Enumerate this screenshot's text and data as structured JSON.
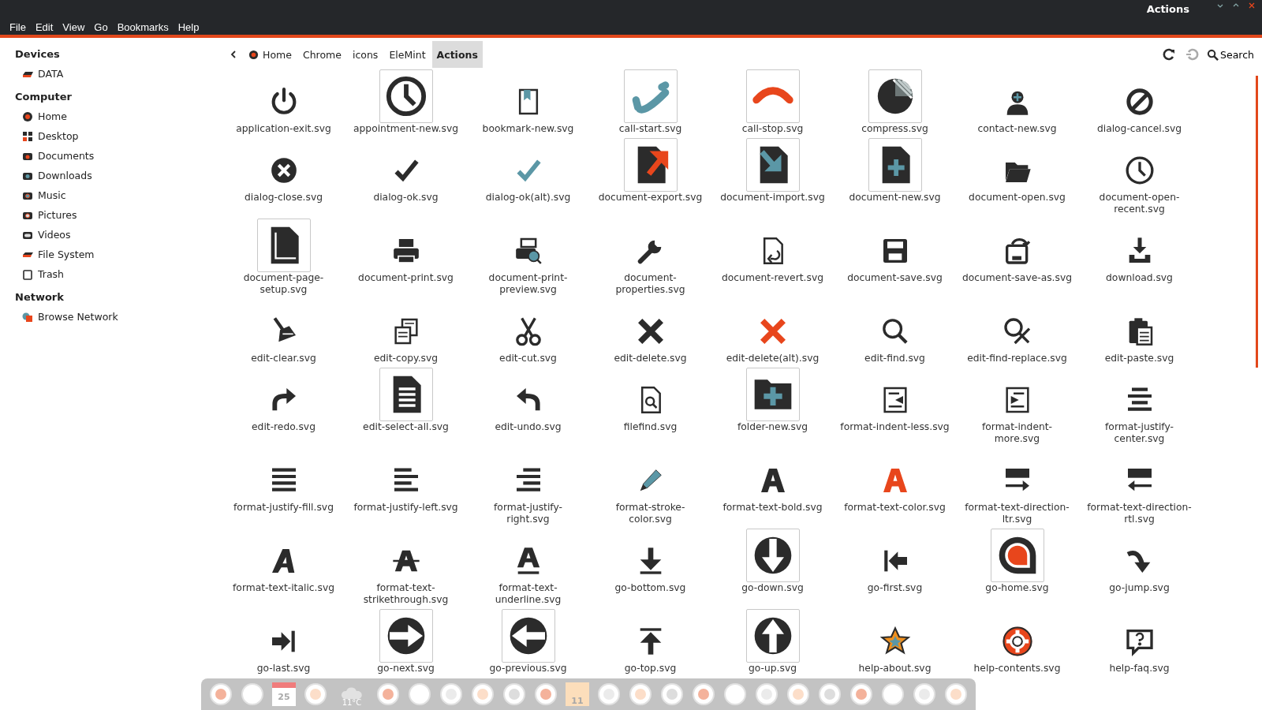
{
  "window": {
    "title": "Actions"
  },
  "menu": [
    "File",
    "Edit",
    "View",
    "Go",
    "Bookmarks",
    "Help"
  ],
  "sidebar": [
    {
      "heading": "Devices",
      "items": [
        {
          "label": "DATA"
        }
      ]
    },
    {
      "heading": "Computer",
      "items": [
        {
          "label": "Home"
        },
        {
          "label": "Desktop"
        },
        {
          "label": "Documents"
        },
        {
          "label": "Downloads"
        },
        {
          "label": "Music"
        },
        {
          "label": "Pictures"
        },
        {
          "label": "Videos"
        },
        {
          "label": "File System"
        },
        {
          "label": "Trash"
        }
      ]
    },
    {
      "heading": "Network",
      "items": [
        {
          "label": "Browse Network"
        }
      ]
    }
  ],
  "path": [
    {
      "label": "Home",
      "selected": false
    },
    {
      "label": "Chrome",
      "selected": false
    },
    {
      "label": "icons",
      "selected": false
    },
    {
      "label": "EleMint",
      "selected": false
    },
    {
      "label": "Actions",
      "selected": true
    }
  ],
  "search": {
    "label": "Search"
  },
  "files": [
    {
      "label": "application-exit.svg",
      "framed": false
    },
    {
      "label": "appointment-new.svg",
      "framed": true
    },
    {
      "label": "bookmark-new.svg",
      "framed": false
    },
    {
      "label": "call-start.svg",
      "framed": true
    },
    {
      "label": "call-stop.svg",
      "framed": true
    },
    {
      "label": "compress.svg",
      "framed": true
    },
    {
      "label": "contact-new.svg",
      "framed": false
    },
    {
      "label": "dialog-cancel.svg",
      "framed": false
    },
    {
      "label": "dialog-close.svg",
      "framed": false
    },
    {
      "label": "dialog-ok.svg",
      "framed": false
    },
    {
      "label": "dialog-ok(alt).svg",
      "framed": false
    },
    {
      "label": "document-export.svg",
      "framed": true
    },
    {
      "label": "document-import.svg",
      "framed": true
    },
    {
      "label": "document-new.svg",
      "framed": true
    },
    {
      "label": "document-open.svg",
      "framed": false
    },
    {
      "label": "document-open-recent.svg",
      "framed": false
    },
    {
      "label": "document-page-setup.svg",
      "framed": true
    },
    {
      "label": "document-print.svg",
      "framed": false
    },
    {
      "label": "document-print-preview.svg",
      "framed": false
    },
    {
      "label": "document-properties.svg",
      "framed": false
    },
    {
      "label": "document-revert.svg",
      "framed": false
    },
    {
      "label": "document-save.svg",
      "framed": false
    },
    {
      "label": "document-save-as.svg",
      "framed": false
    },
    {
      "label": "download.svg",
      "framed": false
    },
    {
      "label": "edit-clear.svg",
      "framed": false
    },
    {
      "label": "edit-copy.svg",
      "framed": false
    },
    {
      "label": "edit-cut.svg",
      "framed": false
    },
    {
      "label": "edit-delete.svg",
      "framed": false
    },
    {
      "label": "edit-delete(alt).svg",
      "framed": false
    },
    {
      "label": "edit-find.svg",
      "framed": false
    },
    {
      "label": "edit-find-replace.svg",
      "framed": false
    },
    {
      "label": "edit-paste.svg",
      "framed": false
    },
    {
      "label": "edit-redo.svg",
      "framed": false
    },
    {
      "label": "edit-select-all.svg",
      "framed": true
    },
    {
      "label": "edit-undo.svg",
      "framed": false
    },
    {
      "label": "filefind.svg",
      "framed": false
    },
    {
      "label": "folder-new.svg",
      "framed": true
    },
    {
      "label": "format-indent-less.svg",
      "framed": false
    },
    {
      "label": "format-indent-more.svg",
      "framed": false
    },
    {
      "label": "format-justify-center.svg",
      "framed": false
    },
    {
      "label": "format-justify-fill.svg",
      "framed": false
    },
    {
      "label": "format-justify-left.svg",
      "framed": false
    },
    {
      "label": "format-justify-right.svg",
      "framed": false
    },
    {
      "label": "format-stroke-color.svg",
      "framed": false
    },
    {
      "label": "format-text-bold.svg",
      "framed": false
    },
    {
      "label": "format-text-color.svg",
      "framed": false
    },
    {
      "label": "format-text-direction-ltr.svg",
      "framed": false
    },
    {
      "label": "format-text-direction-rtl.svg",
      "framed": false
    },
    {
      "label": "format-text-italic.svg",
      "framed": false
    },
    {
      "label": "format-text-strikethrough.svg",
      "framed": false
    },
    {
      "label": "format-text-underline.svg",
      "framed": false
    },
    {
      "label": "go-bottom.svg",
      "framed": false
    },
    {
      "label": "go-down.svg",
      "framed": true
    },
    {
      "label": "go-first.svg",
      "framed": false
    },
    {
      "label": "go-home.svg",
      "framed": true
    },
    {
      "label": "go-jump.svg",
      "framed": false
    },
    {
      "label": "go-last.svg",
      "framed": false
    },
    {
      "label": "go-next.svg",
      "framed": true
    },
    {
      "label": "go-previous.svg",
      "framed": true
    },
    {
      "label": "go-top.svg",
      "framed": false
    },
    {
      "label": "go-up.svg",
      "framed": true
    },
    {
      "label": "help-about.svg",
      "framed": false
    },
    {
      "label": "help-contents.svg",
      "framed": false
    },
    {
      "label": "help-faq.svg",
      "framed": false
    }
  ],
  "dock": [
    {
      "kind": "app"
    },
    {
      "kind": "app"
    },
    {
      "kind": "calendar",
      "text": "25"
    },
    {
      "kind": "app"
    },
    {
      "kind": "weather",
      "text": "11°C"
    },
    {
      "kind": "app"
    },
    {
      "kind": "app"
    },
    {
      "kind": "app"
    },
    {
      "kind": "app"
    },
    {
      "kind": "app"
    },
    {
      "kind": "app"
    },
    {
      "kind": "note",
      "text": "11"
    },
    {
      "kind": "app"
    },
    {
      "kind": "app"
    },
    {
      "kind": "app"
    },
    {
      "kind": "app"
    },
    {
      "kind": "app"
    },
    {
      "kind": "app"
    },
    {
      "kind": "app"
    },
    {
      "kind": "app"
    },
    {
      "kind": "app"
    },
    {
      "kind": "app"
    },
    {
      "kind": "app"
    },
    {
      "kind": "app"
    }
  ]
}
